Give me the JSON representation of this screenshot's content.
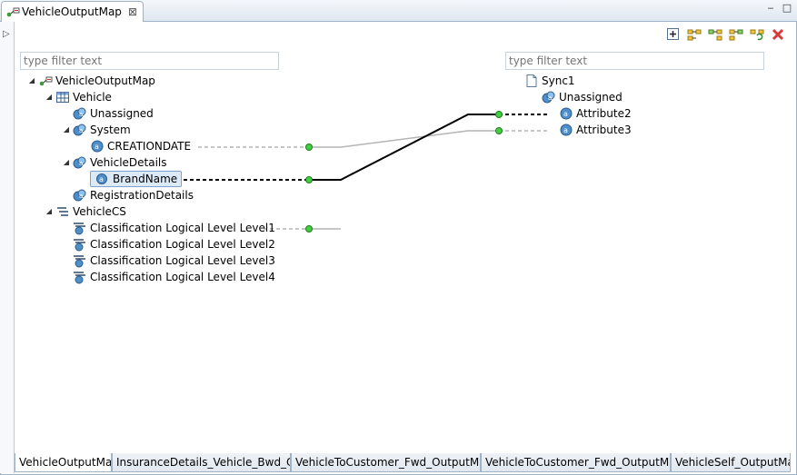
{
  "editor_tab": {
    "title": "VehicleOutputMap",
    "close": "⊠"
  },
  "window_buttons": {
    "minimize": "‒",
    "maximize": "□"
  },
  "left_strip": {
    "expand": "▷"
  },
  "toolbar_icons": [
    "add-mapping-icon",
    "layout-icon-1",
    "layout-icon-2",
    "layout-icon-3",
    "refresh-icon",
    "delete-icon"
  ],
  "filters": {
    "left_placeholder": "type filter text",
    "right_placeholder": "type filter text"
  },
  "left_tree": [
    {
      "id": "n0",
      "label": "VehicleOutputMap",
      "twisty": "◢",
      "icon": "map"
    },
    {
      "id": "n1",
      "label": "Vehicle",
      "twisty": "◢",
      "icon": "table"
    },
    {
      "id": "n2",
      "label": "Unassigned",
      "twisty": "",
      "icon": "attr-group"
    },
    {
      "id": "n3",
      "label": "System",
      "twisty": "◢",
      "icon": "attr-group"
    },
    {
      "id": "n4",
      "label": "CREATIONDATE",
      "twisty": "",
      "icon": "attr"
    },
    {
      "id": "n5",
      "label": "VehicleDetails",
      "twisty": "◢",
      "icon": "attr-group"
    },
    {
      "id": "n6",
      "label": "BrandName",
      "twisty": "",
      "icon": "attr",
      "selected": true
    },
    {
      "id": "n7",
      "label": "RegistrationDetails",
      "twisty": "",
      "icon": "attr-group"
    },
    {
      "id": "n8",
      "label": "VehicleCS",
      "twisty": "◢",
      "icon": "cs"
    },
    {
      "id": "n9",
      "label": "Classification Logical Level Level1",
      "twisty": "",
      "icon": "level"
    },
    {
      "id": "n10",
      "label": "Classification Logical Level Level2",
      "twisty": "",
      "icon": "level"
    },
    {
      "id": "n11",
      "label": "Classification Logical Level Level3",
      "twisty": "",
      "icon": "level"
    },
    {
      "id": "n12",
      "label": "Classification Logical Level Level4",
      "twisty": "",
      "icon": "level"
    }
  ],
  "right_tree": [
    {
      "id": "r0",
      "label": "Sync1",
      "icon": "file"
    },
    {
      "id": "r1",
      "label": "Unassigned",
      "icon": "attr-group"
    },
    {
      "id": "r2",
      "label": "Attribute2",
      "icon": "attr"
    },
    {
      "id": "r3",
      "label": "Attribute3",
      "icon": "attr"
    }
  ],
  "bottom_tabs": [
    {
      "label": "VehicleOutputMap",
      "active": true
    },
    {
      "label": "InsuranceDetails_Vehicle_Bwd_Ou..."
    },
    {
      "label": "VehicleToCustomer_Fwd_OutputMa..."
    },
    {
      "label": "VehicleToCustomer_Fwd_OutputMa..."
    },
    {
      "label": "VehicleSelf_OutputMap"
    }
  ],
  "colors": {
    "tab_border": "#9fb3c8",
    "connector_green": "#3fd13f",
    "mapping_active": "#000000",
    "mapping_inactive": "#b4b4b4"
  }
}
